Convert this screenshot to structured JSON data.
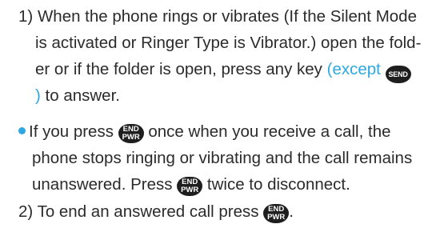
{
  "step1": {
    "number": "1)",
    "line1": "When the phone rings or vibrates (If the Silent Mode",
    "line2": "is activated or Ringer Type is Vibrator.) open the fold-",
    "line3_text": "er or if the folder is open, press any key",
    "line3_accent": "(except",
    "line4_accent": ")",
    "line4_text": "to answer."
  },
  "note": {
    "line1_before": "If you press",
    "line1_after": "once when you receive a call, the",
    "line2": "phone stops ringing or vibrating and the call remains",
    "line3_before": "unanswered. Press",
    "line3_after": "twice to disconnect."
  },
  "step2": {
    "number": "2)",
    "text_before": "To end an answered call press",
    "text_after": "."
  },
  "keys": {
    "send_label": "SEND",
    "end_label_top": "END",
    "end_label_bottom": "PWR"
  },
  "colors": {
    "accent": "#2ea8e0",
    "text": "#2b2b2b",
    "key": "#1e1e1e"
  }
}
